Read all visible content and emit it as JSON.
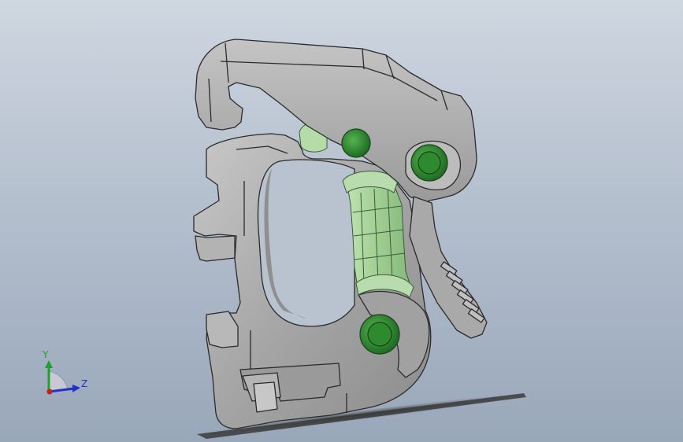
{
  "triad": {
    "y_label": "Y",
    "z_label": "Z",
    "colors": {
      "y_axis": "#1fa12a",
      "z_axis": "#2232c8",
      "x_axis": "#c81e1e"
    }
  },
  "model": {
    "body_color": "#a7a7a7",
    "edge_color": "#2b2b2b",
    "highlight_color": "#a8d39c",
    "pin_color": "#2f8f2f"
  }
}
